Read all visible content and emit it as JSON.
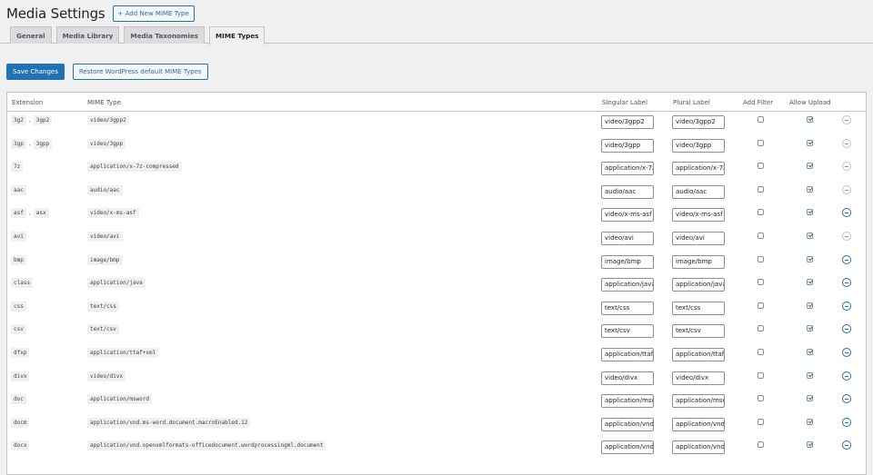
{
  "header": {
    "title": "Media Settings",
    "add_new_label": "+ Add New MIME Type"
  },
  "tabs": [
    {
      "label": "General",
      "active": false
    },
    {
      "label": "Media Library",
      "active": false
    },
    {
      "label": "Media Taxonomies",
      "active": false
    },
    {
      "label": "MIME Types",
      "active": true
    }
  ],
  "actions": {
    "save_label": "Save Changes",
    "restore_label": "Restore WordPress default MIME Types"
  },
  "table": {
    "headers": {
      "extension": "Extension",
      "mime_type": "MIME Type",
      "singular": "Singular Label",
      "plural": "Plural Label",
      "add_filter": "Add Filter",
      "allow_upload": "Allow Upload"
    },
    "rows": [
      {
        "extensions": [
          "3g2",
          "3gp2"
        ],
        "mime": "video/3gpp2",
        "singular": "video/3gpp2",
        "plural": "video/3gpp2",
        "add_filter": false,
        "allow_upload": true
      },
      {
        "extensions": [
          "3gp",
          "3gpp"
        ],
        "mime": "video/3gpp",
        "singular": "video/3gpp",
        "plural": "video/3gpp",
        "add_filter": false,
        "allow_upload": true
      },
      {
        "extensions": [
          "7z"
        ],
        "mime": "application/x-7z-compressed",
        "singular": "application/x-7z",
        "plural": "application/x-7z",
        "add_filter": false,
        "allow_upload": true
      },
      {
        "extensions": [
          "aac"
        ],
        "mime": "audio/aac",
        "singular": "audio/aac",
        "plural": "audio/aac",
        "add_filter": false,
        "allow_upload": true
      },
      {
        "extensions": [
          "asf",
          "asx"
        ],
        "mime": "video/x-ms-asf",
        "singular": "video/x-ms-asf",
        "plural": "video/x-ms-asf",
        "add_filter": false,
        "allow_upload": true
      },
      {
        "extensions": [
          "avi"
        ],
        "mime": "video/avi",
        "singular": "video/avi",
        "plural": "video/avi",
        "add_filter": false,
        "allow_upload": true
      },
      {
        "extensions": [
          "bmp"
        ],
        "mime": "image/bmp",
        "singular": "image/bmp",
        "plural": "image/bmp",
        "add_filter": false,
        "allow_upload": true
      },
      {
        "extensions": [
          "class"
        ],
        "mime": "application/java",
        "singular": "application/java",
        "plural": "application/java",
        "add_filter": false,
        "allow_upload": true
      },
      {
        "extensions": [
          "css"
        ],
        "mime": "text/css",
        "singular": "text/css",
        "plural": "text/css",
        "add_filter": false,
        "allow_upload": true
      },
      {
        "extensions": [
          "csv"
        ],
        "mime": "text/csv",
        "singular": "text/csv",
        "plural": "text/csv",
        "add_filter": false,
        "allow_upload": true
      },
      {
        "extensions": [
          "dfxp"
        ],
        "mime": "application/ttaf+xml",
        "singular": "application/ttaf+",
        "plural": "application/ttaf+",
        "add_filter": false,
        "allow_upload": true
      },
      {
        "extensions": [
          "divx"
        ],
        "mime": "video/divx",
        "singular": "video/divx",
        "plural": "video/divx",
        "add_filter": false,
        "allow_upload": true
      },
      {
        "extensions": [
          "doc"
        ],
        "mime": "application/msword",
        "singular": "application/msw",
        "plural": "application/msw",
        "add_filter": false,
        "allow_upload": true
      },
      {
        "extensions": [
          "docm"
        ],
        "mime": "application/vnd.ms-word.document.macroEnabled.12",
        "singular": "application/vnd.r",
        "plural": "application/vnd.r",
        "add_filter": false,
        "allow_upload": true
      },
      {
        "extensions": [
          "docx"
        ],
        "mime": "application/vnd.openxmlformats-officedocument.wordprocessingml.document",
        "singular": "application/vnd.c",
        "plural": "application/vnd.c",
        "add_filter": false,
        "allow_upload": true
      }
    ]
  },
  "colors": {
    "accent": "#2271b1",
    "background": "#f0f0f1",
    "border": "#c3c4c7"
  }
}
